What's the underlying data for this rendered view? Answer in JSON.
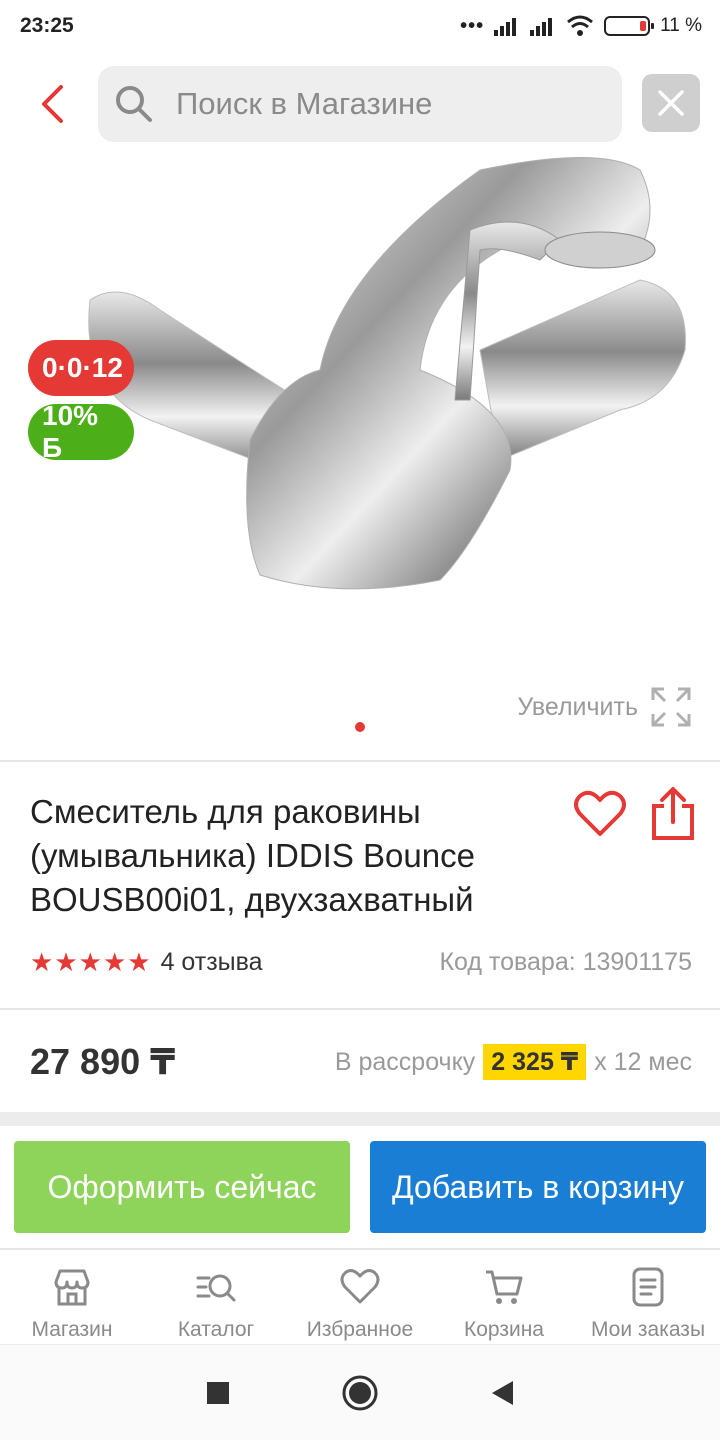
{
  "status_bar": {
    "time": "23:25",
    "battery": "11 %"
  },
  "search": {
    "placeholder": "Поиск в Магазине"
  },
  "gallery": {
    "badge_installment": "0·0·12",
    "badge_bonus": "10% Б",
    "zoom_label": "Увеличить"
  },
  "product": {
    "title": "Смеситель для раковины (умывальника) IDDIS Bounce BOUSB00i01, двухзахватный",
    "rating": 5,
    "reviews": "4 отзыва",
    "sku": "Код товара: 13901175",
    "price": "27 890 ₸",
    "installment_prefix": "В рассрочку",
    "installment_amount": "2 325 ₸",
    "installment_suffix": "х 12 мес"
  },
  "actions": {
    "buy_now": "Оформить сейчас",
    "add_to_cart": "Добавить в корзину"
  },
  "bottom_nav": [
    {
      "label": "Магазин",
      "icon": "store-icon"
    },
    {
      "label": "Каталог",
      "icon": "catalog-search-icon"
    },
    {
      "label": "Избранное",
      "icon": "heart-icon"
    },
    {
      "label": "Корзина",
      "icon": "cart-icon"
    },
    {
      "label": "Мои заказы",
      "icon": "orders-icon"
    }
  ],
  "colors": {
    "accent_red": "#e53935",
    "buy_green": "#8fd45a",
    "cart_blue": "#1a7fd4",
    "installment_yellow": "#ffd600",
    "bonus_green": "#4caf1a"
  }
}
